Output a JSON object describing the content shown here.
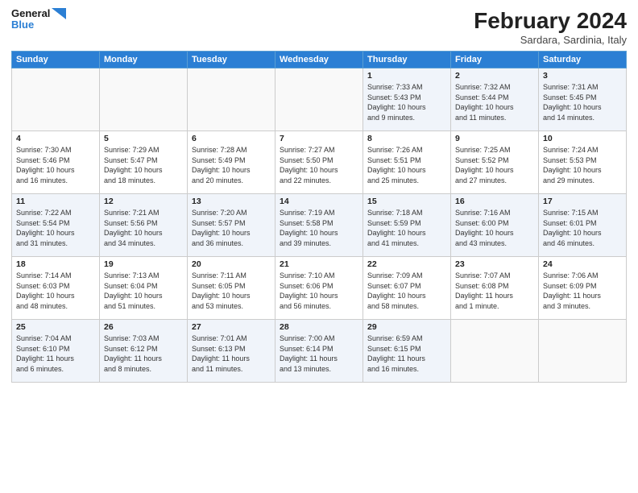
{
  "logo": {
    "line1": "General",
    "line2": "Blue"
  },
  "title": "February 2024",
  "subtitle": "Sardara, Sardinia, Italy",
  "days_of_week": [
    "Sunday",
    "Monday",
    "Tuesday",
    "Wednesday",
    "Thursday",
    "Friday",
    "Saturday"
  ],
  "weeks": [
    [
      {
        "num": "",
        "info": ""
      },
      {
        "num": "",
        "info": ""
      },
      {
        "num": "",
        "info": ""
      },
      {
        "num": "",
        "info": ""
      },
      {
        "num": "1",
        "info": "Sunrise: 7:33 AM\nSunset: 5:43 PM\nDaylight: 10 hours\nand 9 minutes."
      },
      {
        "num": "2",
        "info": "Sunrise: 7:32 AM\nSunset: 5:44 PM\nDaylight: 10 hours\nand 11 minutes."
      },
      {
        "num": "3",
        "info": "Sunrise: 7:31 AM\nSunset: 5:45 PM\nDaylight: 10 hours\nand 14 minutes."
      }
    ],
    [
      {
        "num": "4",
        "info": "Sunrise: 7:30 AM\nSunset: 5:46 PM\nDaylight: 10 hours\nand 16 minutes."
      },
      {
        "num": "5",
        "info": "Sunrise: 7:29 AM\nSunset: 5:47 PM\nDaylight: 10 hours\nand 18 minutes."
      },
      {
        "num": "6",
        "info": "Sunrise: 7:28 AM\nSunset: 5:49 PM\nDaylight: 10 hours\nand 20 minutes."
      },
      {
        "num": "7",
        "info": "Sunrise: 7:27 AM\nSunset: 5:50 PM\nDaylight: 10 hours\nand 22 minutes."
      },
      {
        "num": "8",
        "info": "Sunrise: 7:26 AM\nSunset: 5:51 PM\nDaylight: 10 hours\nand 25 minutes."
      },
      {
        "num": "9",
        "info": "Sunrise: 7:25 AM\nSunset: 5:52 PM\nDaylight: 10 hours\nand 27 minutes."
      },
      {
        "num": "10",
        "info": "Sunrise: 7:24 AM\nSunset: 5:53 PM\nDaylight: 10 hours\nand 29 minutes."
      }
    ],
    [
      {
        "num": "11",
        "info": "Sunrise: 7:22 AM\nSunset: 5:54 PM\nDaylight: 10 hours\nand 31 minutes."
      },
      {
        "num": "12",
        "info": "Sunrise: 7:21 AM\nSunset: 5:56 PM\nDaylight: 10 hours\nand 34 minutes."
      },
      {
        "num": "13",
        "info": "Sunrise: 7:20 AM\nSunset: 5:57 PM\nDaylight: 10 hours\nand 36 minutes."
      },
      {
        "num": "14",
        "info": "Sunrise: 7:19 AM\nSunset: 5:58 PM\nDaylight: 10 hours\nand 39 minutes."
      },
      {
        "num": "15",
        "info": "Sunrise: 7:18 AM\nSunset: 5:59 PM\nDaylight: 10 hours\nand 41 minutes."
      },
      {
        "num": "16",
        "info": "Sunrise: 7:16 AM\nSunset: 6:00 PM\nDaylight: 10 hours\nand 43 minutes."
      },
      {
        "num": "17",
        "info": "Sunrise: 7:15 AM\nSunset: 6:01 PM\nDaylight: 10 hours\nand 46 minutes."
      }
    ],
    [
      {
        "num": "18",
        "info": "Sunrise: 7:14 AM\nSunset: 6:03 PM\nDaylight: 10 hours\nand 48 minutes."
      },
      {
        "num": "19",
        "info": "Sunrise: 7:13 AM\nSunset: 6:04 PM\nDaylight: 10 hours\nand 51 minutes."
      },
      {
        "num": "20",
        "info": "Sunrise: 7:11 AM\nSunset: 6:05 PM\nDaylight: 10 hours\nand 53 minutes."
      },
      {
        "num": "21",
        "info": "Sunrise: 7:10 AM\nSunset: 6:06 PM\nDaylight: 10 hours\nand 56 minutes."
      },
      {
        "num": "22",
        "info": "Sunrise: 7:09 AM\nSunset: 6:07 PM\nDaylight: 10 hours\nand 58 minutes."
      },
      {
        "num": "23",
        "info": "Sunrise: 7:07 AM\nSunset: 6:08 PM\nDaylight: 11 hours\nand 1 minute."
      },
      {
        "num": "24",
        "info": "Sunrise: 7:06 AM\nSunset: 6:09 PM\nDaylight: 11 hours\nand 3 minutes."
      }
    ],
    [
      {
        "num": "25",
        "info": "Sunrise: 7:04 AM\nSunset: 6:10 PM\nDaylight: 11 hours\nand 6 minutes."
      },
      {
        "num": "26",
        "info": "Sunrise: 7:03 AM\nSunset: 6:12 PM\nDaylight: 11 hours\nand 8 minutes."
      },
      {
        "num": "27",
        "info": "Sunrise: 7:01 AM\nSunset: 6:13 PM\nDaylight: 11 hours\nand 11 minutes."
      },
      {
        "num": "28",
        "info": "Sunrise: 7:00 AM\nSunset: 6:14 PM\nDaylight: 11 hours\nand 13 minutes."
      },
      {
        "num": "29",
        "info": "Sunrise: 6:59 AM\nSunset: 6:15 PM\nDaylight: 11 hours\nand 16 minutes."
      },
      {
        "num": "",
        "info": ""
      },
      {
        "num": "",
        "info": ""
      }
    ]
  ]
}
